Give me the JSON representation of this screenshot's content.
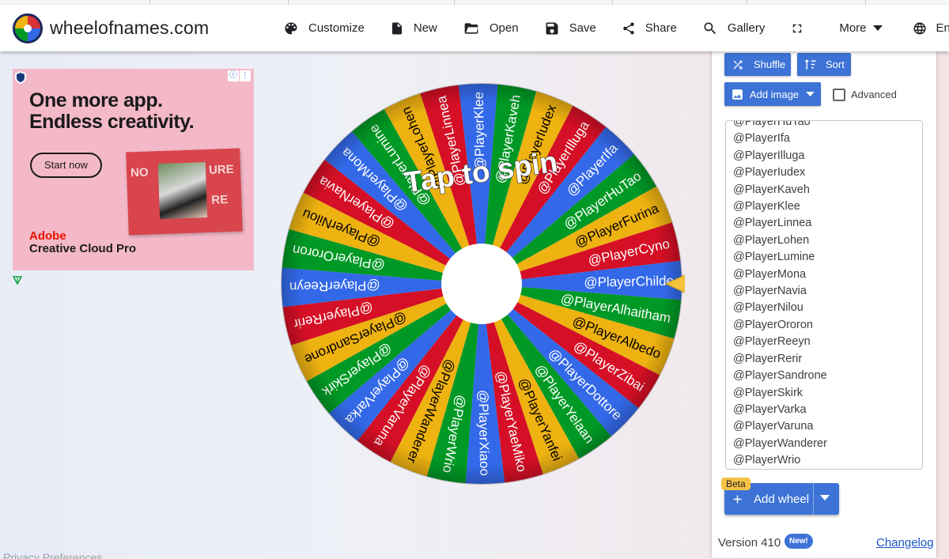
{
  "header": {
    "brand": "wheelofnames.com",
    "nav": [
      {
        "label": "Customize",
        "icon": "palette-icon"
      },
      {
        "label": "New",
        "icon": "file-icon"
      },
      {
        "label": "Open",
        "icon": "folder-open-icon"
      },
      {
        "label": "Save",
        "icon": "save-icon"
      },
      {
        "label": "Share",
        "icon": "share-icon"
      },
      {
        "label": "Gallery",
        "icon": "search-icon"
      },
      {
        "label": "",
        "icon": "fullscreen-icon"
      },
      {
        "label": "More",
        "icon": "chevron-down-icon"
      },
      {
        "label": "English",
        "icon": "globe-icon"
      }
    ]
  },
  "ad": {
    "headline_line1": "One more app.",
    "headline_line2": "Endless creativity.",
    "cta": "Start now",
    "card_text_left": "NO",
    "card_text_right": "URE",
    "card_text_right2": "RE",
    "brand_line1": "Adobe",
    "brand_line2": "Creative Cloud Pro"
  },
  "wheel": {
    "center_text": "Tap to spin",
    "colors": [
      "#3369e8",
      "#009925",
      "#eeb211",
      "#d50f25"
    ],
    "segments": [
      "@PlayerChilde",
      "@PlayerAlhaitham",
      "@PlayerAlbedo",
      "@PlayerZibai",
      "@PlayerDottore",
      "@PlayerYelaan",
      "@PlayerYanfei",
      "@PlayerYaeMiko",
      "@PlayerXiaoo",
      "@PlayerWrio",
      "@PlayerWanderer",
      "@PlayerVaruna",
      "@PlayerVarka",
      "@PlayerSkirk",
      "@PlayerSandrone",
      "@PlayerRerir",
      "@PlayerReeyn",
      "@PlayerOroron",
      "@PlayerNilou",
      "@PlayerNavia",
      "@PlayerMona",
      "@PlayerLumine",
      "@PlayerLohen",
      "@PlayerLinnea",
      "@PlayerKlee",
      "@PlayerKaveh",
      "@PlayerIudex",
      "@PlayerIlluga",
      "@PlayerIfa",
      "@PlayerHuTao",
      "@PlayerFurina",
      "@PlayerCyno"
    ]
  },
  "panel": {
    "shuffle": "Shuffle",
    "sort": "Sort",
    "add_image": "Add image",
    "advanced": "Advanced",
    "names": [
      "@PlayerHuTao",
      "@PlayerIfa",
      "@PlayerIlluga",
      "@PlayerIudex",
      "@PlayerKaveh",
      "@PlayerKlee",
      "@PlayerLinnea",
      "@PlayerLohen",
      "@PlayerLumine",
      "@PlayerMona",
      "@PlayerNavia",
      "@PlayerNilou",
      "@PlayerOroron",
      "@PlayerReeyn",
      "@PlayerRerir",
      "@PlayerSandrone",
      "@PlayerSkirk",
      "@PlayerVarka",
      "@PlayerVaruna",
      "@PlayerWanderer",
      "@PlayerWrio"
    ],
    "beta": "Beta",
    "add_wheel": "Add wheel",
    "version": "Version 410",
    "new_badge": "New!",
    "changelog": "Changelog"
  },
  "footer": {
    "privacy": "Privacy Preferences"
  }
}
